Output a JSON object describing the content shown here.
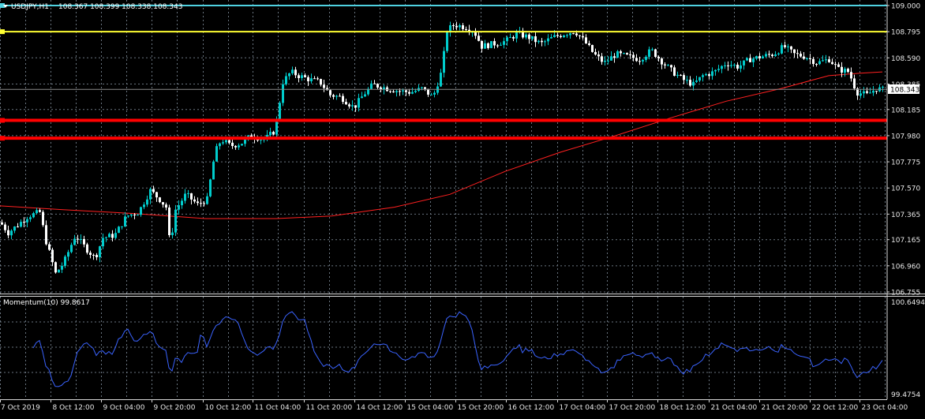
{
  "window": {
    "symbol": "USDJPY,H1",
    "ohlc": "108.367 108.399 108.338 108.343"
  },
  "main_pane": {
    "price_axis": [
      "109.000",
      "108.795",
      "108.590",
      "108.385",
      "108.185",
      "107.980",
      "107.775",
      "107.570",
      "107.365",
      "107.165",
      "106.960",
      "106.755"
    ],
    "current_price": "108.343",
    "levels": [
      {
        "name": "cyan-level",
        "price": 109.0,
        "color": "#4fd1e0"
      },
      {
        "name": "yellow-level",
        "price": 108.795,
        "color": "#ffff33"
      },
      {
        "name": "red-level-1",
        "price": 108.1,
        "color": "#ff0000"
      },
      {
        "name": "red-level-2",
        "price": 107.96,
        "color": "#ff0000"
      }
    ],
    "ma_color": "#ff2020",
    "up_candle_color": "#00cccc",
    "down_candle_color": "#ffffff"
  },
  "indicator_pane": {
    "label": "Momentum(10) 99.8617",
    "axis": [
      "100.6494",
      "99.4754"
    ],
    "line_color": "#3a63ff"
  },
  "time_axis": [
    "7 Oct 2019",
    "8 Oct 12:00",
    "9 Oct 04:00",
    "9 Oct 20:00",
    "10 Oct 12:00",
    "11 Oct 04:00",
    "11 Oct 20:00",
    "14 Oct 12:00",
    "15 Oct 04:00",
    "15 Oct 20:00",
    "16 Oct 12:00",
    "17 Oct 04:00",
    "17 Oct 20:00",
    "18 Oct 12:00",
    "21 Oct 04:00",
    "21 Oct 20:00",
    "22 Oct 12:00",
    "23 Oct 04:00"
  ],
  "colors": {
    "background": "#000000",
    "grid": "#6a7580",
    "axis_text": "#e8e8e8"
  }
}
